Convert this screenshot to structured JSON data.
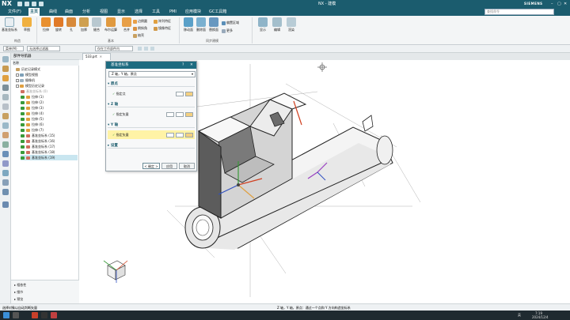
{
  "titlebar": {
    "app_logo": "NX",
    "window_title": "NX - 建模",
    "brand": "SIEMENS"
  },
  "menubar": {
    "items": [
      "文件(F)",
      "主页",
      "曲线",
      "曲面",
      "分析",
      "视图",
      "显示",
      "选择",
      "工具",
      "PMI",
      "应用模块",
      "GC工具箱"
    ],
    "active_index": 1,
    "search_placeholder": "查找命令"
  },
  "ribbon": {
    "buttons": [
      "基准坐标系",
      "草图",
      "拉伸",
      "旋转",
      "孔",
      "加厚",
      "缝合",
      "布尔运算",
      "合并",
      "求差",
      "拔模",
      "修剪体",
      "同步建模"
    ],
    "small_items": [
      "边倒圆",
      "倒斜角",
      "抽壳",
      "阵列特征",
      "镜像特征",
      "移动面",
      "删除面",
      "替换面",
      "偏置区域",
      "更多"
    ],
    "groups": [
      "构造",
      "基本",
      "同步建模"
    ],
    "right_labels": [
      "显示",
      "编辑",
      "渲染"
    ]
  },
  "toolbar2": {
    "filter_combo": "菜单(M)",
    "select_combo": "无选择过滤器",
    "assembly_combo": "仅在工作部件内"
  },
  "file_tab": "533.prt",
  "navigator": {
    "title": "部件导航器",
    "column_header": "名称",
    "items": [
      "历史记录模式",
      "模型视图",
      "摄像机",
      "模型历史记录",
      "基准坐标系 (0)",
      "拉伸 (1)",
      "拉伸 (2)",
      "拉伸 (3)",
      "拉伸 (4)",
      "拉伸 (5)",
      "拉伸 (6)",
      "拉伸 (7)",
      "基准坐标系 (15)",
      "基准坐标系 (16)",
      "基准坐标系 (17)",
      "基准坐标系 (18)",
      "基准坐标系 (19)"
    ],
    "bottom_labels": [
      "相依性",
      "细节",
      "预览"
    ]
  },
  "dialog": {
    "title": "基准坐标系",
    "type_value": "Z 轴，Y 轴，原点",
    "sections": [
      "原点",
      "Z 轴",
      "Y 轴",
      "设置"
    ],
    "origin_label": "指定点",
    "z_label": "指定矢量",
    "y_label": "指定矢量",
    "ok": "< 确定 >",
    "apply": "应用",
    "cancel": "取消"
  },
  "statusbar": {
    "left_text": "选择对象以自动判断矢量",
    "center_text": "Z 轴，Y 轴，原点：通过一个点和 Y 方向构造坐标系"
  },
  "taskbar": {
    "time": "7:19",
    "date": "2024/12/4",
    "lang": "英"
  },
  "colors": {
    "nx_teal": "#1b5c6e",
    "dialog_header": "#1e6b80",
    "highlight": "#fff3a6",
    "axis_green": "#3a9a3a",
    "axis_red": "#d04020",
    "axis_blue": "#3050c0"
  }
}
